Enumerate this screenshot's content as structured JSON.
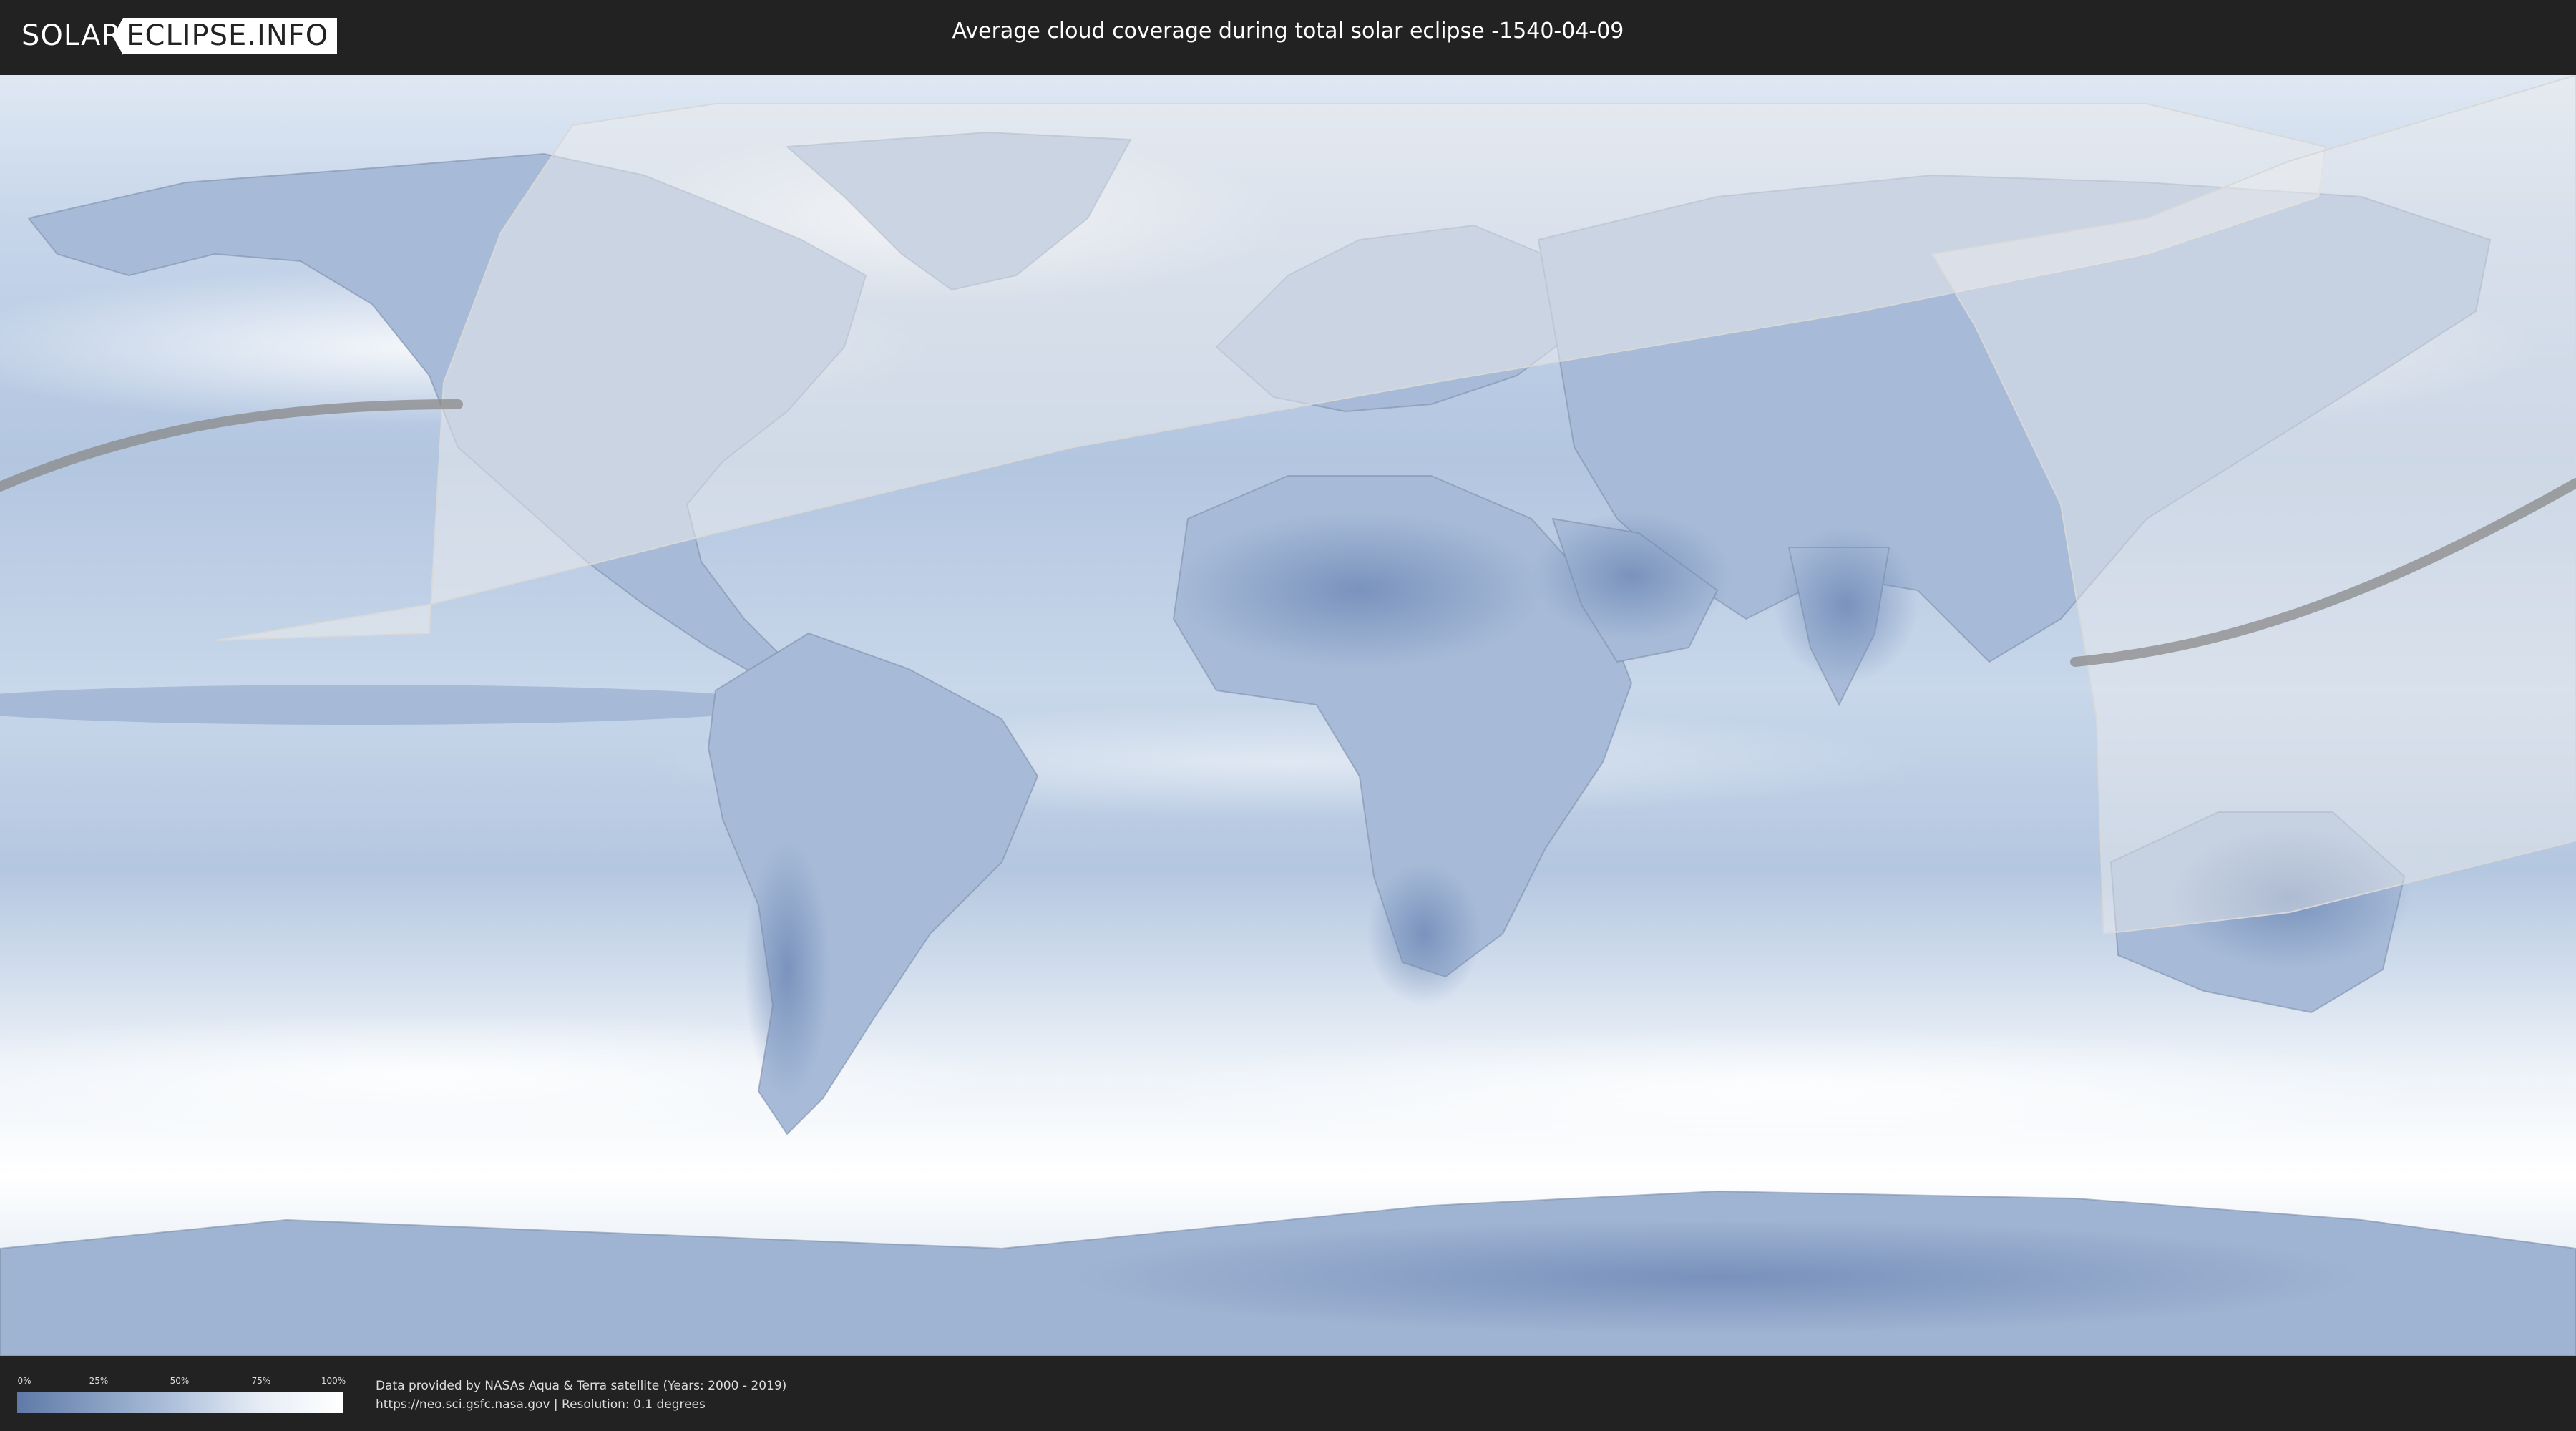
{
  "header": {
    "logo_left": "SOLAR",
    "logo_right": "ECLIPSE.INFO",
    "title": "Average cloud coverage during total solar eclipse -1540-04-09"
  },
  "map": {
    "content": "world cloud coverage map with eclipse visibility region and central path"
  },
  "legend": {
    "ticks": [
      "0%",
      "25%",
      "50%",
      "75%",
      "100%"
    ],
    "color_low": "#5f7aa8",
    "color_high": "#ffffff"
  },
  "footer": {
    "credit_line1": "Data provided by NASAs Aqua & Terra satellite (Years: 2000 - 2019)",
    "credit_line2": "https://neo.sci.gsfc.nasa.gov | Resolution: 0.1 degrees"
  },
  "colors": {
    "background": "#222222",
    "clear_sky": "#6a84b3",
    "cloudy": "#ffffff",
    "eclipse_band": "#e8e8e8",
    "central_path": "#8a8a8a"
  }
}
